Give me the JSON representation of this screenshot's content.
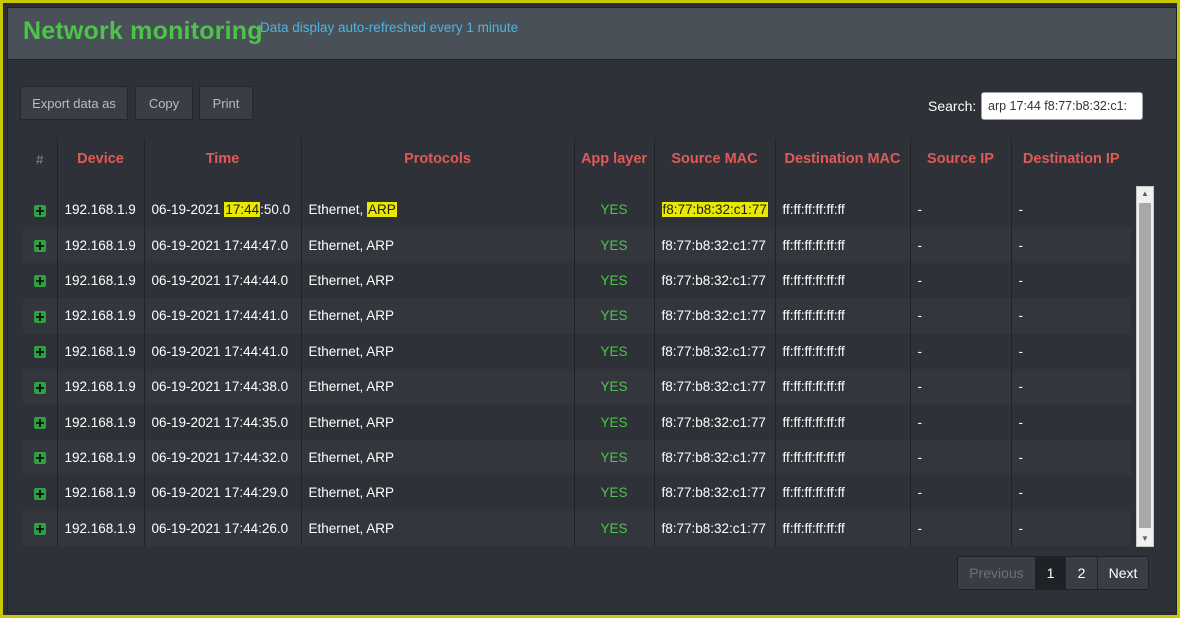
{
  "header": {
    "title": "Network monitoring",
    "subtitle": "Data display auto-refreshed every 1 minute"
  },
  "toolbar": {
    "export_label": "Export data as",
    "copy_label": "Copy",
    "print_label": "Print"
  },
  "search": {
    "label": "Search:",
    "value": "arp 17:44 f8:77:b8:32:c1:"
  },
  "table": {
    "columns": [
      "#",
      "Device",
      "Time",
      "Protocols",
      "App layer",
      "Source MAC",
      "Destination MAC",
      "Source IP",
      "Destination IP"
    ],
    "rows": [
      {
        "device": "192.168.1.9",
        "time_pre": "06-19-2021 ",
        "time_hl": "17:44",
        "time_post": ":50.0",
        "proto_pre": "Ethernet, ",
        "proto_hl": "ARP",
        "app": "YES",
        "src_mac": "f8:77:b8:32:c1:77",
        "dst_mac": "ff:ff:ff:ff:ff:ff",
        "src_ip": "-",
        "dst_ip": "-",
        "highlighted": true
      },
      {
        "device": "192.168.1.9",
        "time_pre": "06-19-2021 17:44:47.0",
        "time_hl": "",
        "time_post": "",
        "proto_pre": "Ethernet, ARP",
        "proto_hl": "",
        "app": "YES",
        "src_mac": "f8:77:b8:32:c1:77",
        "dst_mac": "ff:ff:ff:ff:ff:ff",
        "src_ip": "-",
        "dst_ip": "-",
        "highlighted": false
      },
      {
        "device": "192.168.1.9",
        "time_pre": "06-19-2021 17:44:44.0",
        "time_hl": "",
        "time_post": "",
        "proto_pre": "Ethernet, ARP",
        "proto_hl": "",
        "app": "YES",
        "src_mac": "f8:77:b8:32:c1:77",
        "dst_mac": "ff:ff:ff:ff:ff:ff",
        "src_ip": "-",
        "dst_ip": "-",
        "highlighted": false
      },
      {
        "device": "192.168.1.9",
        "time_pre": "06-19-2021 17:44:41.0",
        "time_hl": "",
        "time_post": "",
        "proto_pre": "Ethernet, ARP",
        "proto_hl": "",
        "app": "YES",
        "src_mac": "f8:77:b8:32:c1:77",
        "dst_mac": "ff:ff:ff:ff:ff:ff",
        "src_ip": "-",
        "dst_ip": "-",
        "highlighted": false
      },
      {
        "device": "192.168.1.9",
        "time_pre": "06-19-2021 17:44:41.0",
        "time_hl": "",
        "time_post": "",
        "proto_pre": "Ethernet, ARP",
        "proto_hl": "",
        "app": "YES",
        "src_mac": "f8:77:b8:32:c1:77",
        "dst_mac": "ff:ff:ff:ff:ff:ff",
        "src_ip": "-",
        "dst_ip": "-",
        "highlighted": false
      },
      {
        "device": "192.168.1.9",
        "time_pre": "06-19-2021 17:44:38.0",
        "time_hl": "",
        "time_post": "",
        "proto_pre": "Ethernet, ARP",
        "proto_hl": "",
        "app": "YES",
        "src_mac": "f8:77:b8:32:c1:77",
        "dst_mac": "ff:ff:ff:ff:ff:ff",
        "src_ip": "-",
        "dst_ip": "-",
        "highlighted": false
      },
      {
        "device": "192.168.1.9",
        "time_pre": "06-19-2021 17:44:35.0",
        "time_hl": "",
        "time_post": "",
        "proto_pre": "Ethernet, ARP",
        "proto_hl": "",
        "app": "YES",
        "src_mac": "f8:77:b8:32:c1:77",
        "dst_mac": "ff:ff:ff:ff:ff:ff",
        "src_ip": "-",
        "dst_ip": "-",
        "highlighted": false
      },
      {
        "device": "192.168.1.9",
        "time_pre": "06-19-2021 17:44:32.0",
        "time_hl": "",
        "time_post": "",
        "proto_pre": "Ethernet, ARP",
        "proto_hl": "",
        "app": "YES",
        "src_mac": "f8:77:b8:32:c1:77",
        "dst_mac": "ff:ff:ff:ff:ff:ff",
        "src_ip": "-",
        "dst_ip": "-",
        "highlighted": false
      },
      {
        "device": "192.168.1.9",
        "time_pre": "06-19-2021 17:44:29.0",
        "time_hl": "",
        "time_post": "",
        "proto_pre": "Ethernet, ARP",
        "proto_hl": "",
        "app": "YES",
        "src_mac": "f8:77:b8:32:c1:77",
        "dst_mac": "ff:ff:ff:ff:ff:ff",
        "src_ip": "-",
        "dst_ip": "-",
        "highlighted": false
      },
      {
        "device": "192.168.1.9",
        "time_pre": "06-19-2021 17:44:26.0",
        "time_hl": "",
        "time_post": "",
        "proto_pre": "Ethernet, ARP",
        "proto_hl": "",
        "app": "YES",
        "src_mac": "f8:77:b8:32:c1:77",
        "dst_mac": "ff:ff:ff:ff:ff:ff",
        "src_ip": "-",
        "dst_ip": "-",
        "highlighted": false
      }
    ]
  },
  "pagination": {
    "previous_label": "Previous",
    "pages": [
      "1",
      "2"
    ],
    "current_page": "1",
    "next_label": "Next"
  },
  "colors": {
    "title": "#4cc44a",
    "subtitle": "#4fb3e0",
    "column_header": "#e05a57",
    "yes": "#4cc44a",
    "highlight": "#e8e800",
    "frame_border": "#c8c800"
  },
  "icons": {
    "row_expand": "plus-square-icon",
    "scroll_up": "triangle-up-icon",
    "scroll_down": "triangle-down-icon"
  }
}
